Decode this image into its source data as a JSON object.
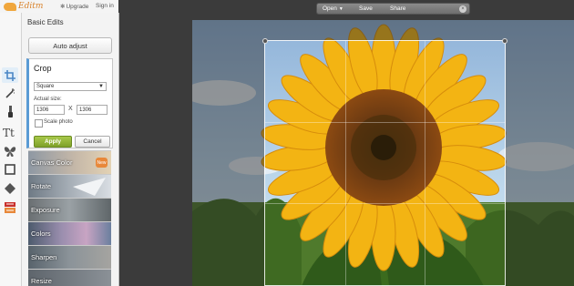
{
  "topbar": {
    "app_name": "Editm",
    "upgrade_label": "Upgrade",
    "signin_label": "Sign in"
  },
  "toolbar": {
    "tools": [
      "crop-icon",
      "magic-wand-icon",
      "brush-icon",
      "text-icon",
      "butterfly-icon",
      "frame-icon",
      "texture-icon",
      "overlay-icon"
    ],
    "active_tool": "crop-icon"
  },
  "panel": {
    "title": "Basic Edits",
    "auto_adjust_label": "Auto adjust",
    "crop": {
      "title": "Crop",
      "ratio_value": "Square",
      "size_label": "Actual size:",
      "width_value": "1306",
      "height_value": "1306",
      "times_symbol": "X",
      "scale_label": "Scale photo",
      "scale_checked": false,
      "apply_label": "Apply",
      "cancel_label": "Cancel"
    },
    "effects": [
      {
        "label": "Canvas Color",
        "badge": "New"
      },
      {
        "label": "Rotate"
      },
      {
        "label": "Exposure"
      },
      {
        "label": "Colors"
      },
      {
        "label": "Sharpen"
      },
      {
        "label": "Resize"
      }
    ]
  },
  "menu": {
    "open_label": "Open",
    "save_label": "Save",
    "share_label": "Share",
    "close_symbol": "×"
  },
  "colors": {
    "accent": "#5a9bd5",
    "apply_green": "#8db234",
    "logo_orange": "#f0a63c",
    "workspace_bg": "#3b3b3b"
  }
}
